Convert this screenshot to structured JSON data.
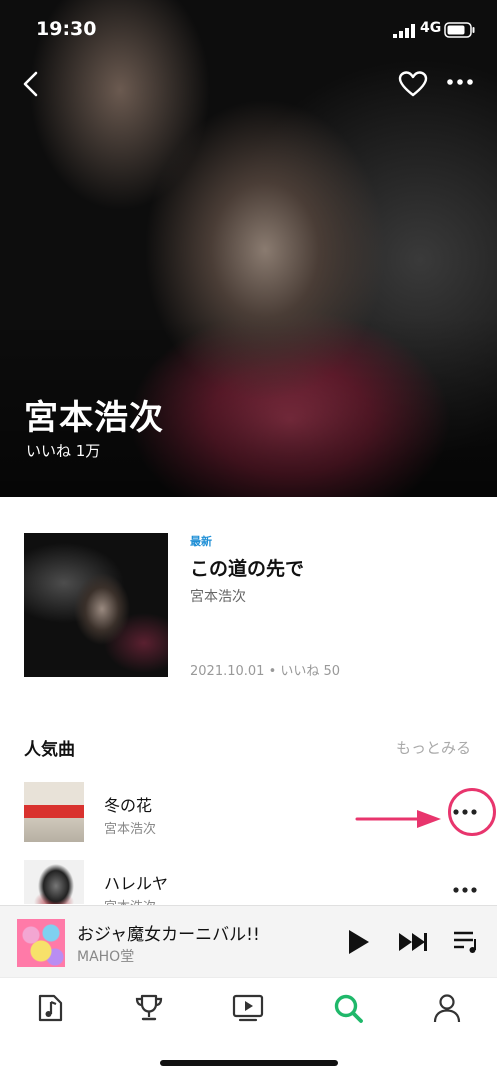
{
  "status_bar": {
    "time": "19:30",
    "network": "4G"
  },
  "artist": {
    "name": "宮本浩次",
    "likes": "いいね 1万"
  },
  "latest_release": {
    "tag": "最新",
    "title": "この道の先で",
    "artist": "宮本浩次",
    "meta": "2021.10.01 • いいね 50"
  },
  "popular": {
    "title": "人気曲",
    "see_more": "もっとみる",
    "tracks": [
      {
        "title": "冬の花",
        "artist": "宮本浩次"
      },
      {
        "title": "ハレルヤ",
        "artist": "宮本浩次"
      }
    ]
  },
  "mini_player": {
    "title": "おジャ魔女カーニバル!!",
    "artist": "MAHO堂"
  },
  "tabs": [
    "music-note-icon",
    "trophy-icon",
    "video-icon",
    "search-icon",
    "profile-icon"
  ],
  "colors": {
    "accent_green": "#1fb86a",
    "highlight_pink": "#e8356d",
    "tag_blue": "#1f8fd6"
  }
}
